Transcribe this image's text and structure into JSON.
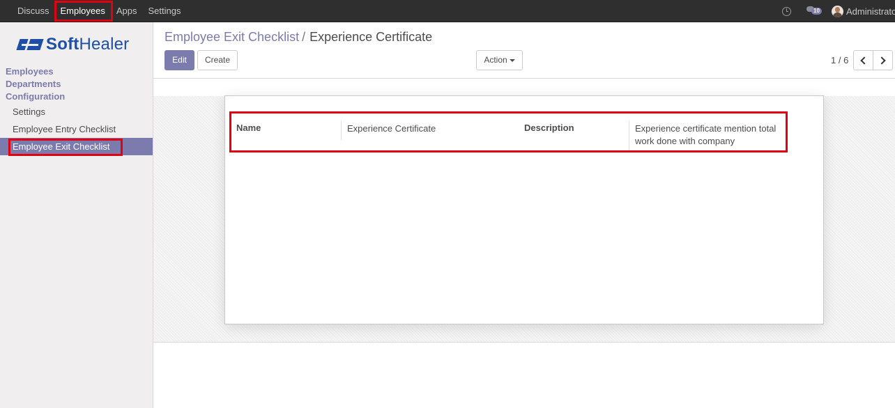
{
  "topbar": {
    "menu": [
      "Discuss",
      "Employees",
      "Apps",
      "Settings"
    ],
    "active_menu": "Employees",
    "messages_count": "10",
    "user_name": "Administrator",
    "icons": [
      "clock-icon",
      "chat-icon",
      "avatar"
    ]
  },
  "sidebar": {
    "logo": {
      "mark": "SH",
      "brand_bold": "Soft",
      "brand_rest": "Healer"
    },
    "sections": [
      "Employees",
      "Departments",
      "Configuration"
    ],
    "items": [
      "Settings",
      "Employee Entry Checklist",
      "Employee Exit Checklist"
    ],
    "active_item": "Employee Exit Checklist"
  },
  "control_panel": {
    "breadcrumb_parent": "Employee Exit Checklist",
    "breadcrumb_sep": "/",
    "breadcrumb_current": "Experience Certificate",
    "edit_label": "Edit",
    "create_label": "Create",
    "action_label": "Action",
    "pager": "1 / 6"
  },
  "form": {
    "name_label": "Name",
    "name_value": "Experience Certificate",
    "description_label": "Description",
    "description_value": "Experience certificate mention total work done with company"
  },
  "colors": {
    "topbar": "#2f2f2f",
    "accent": "#7c7bad",
    "highlight": "#e3000f",
    "logo": "#1d4fa8"
  }
}
